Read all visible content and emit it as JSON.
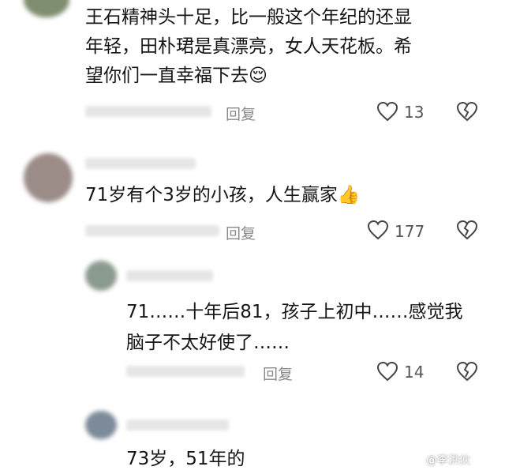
{
  "comments": [
    {
      "text_lines": [
        "王石精神头十足，比一般这个年纪的还显",
        "年轻，田朴珺是真漂亮，女人天花板。希",
        "望你们一直幸福下去😌"
      ],
      "reply_label": "回复",
      "like_count": "13"
    },
    {
      "text_lines": [
        "71岁有个3岁的小孩，人生赢家👍"
      ],
      "reply_label": "回复",
      "like_count": "177"
    },
    {
      "text_lines": [
        "71……十年后81，孩子上初中……感觉我",
        "脑子不太好使了……"
      ],
      "reply_label": "回复",
      "like_count": "14"
    },
    {
      "text_lines": [
        "73岁，51年的"
      ]
    }
  ],
  "icons": {
    "like": "heart-outline-icon",
    "dislike": "broken-heart-icon"
  },
  "watermark": "@李洪伙"
}
